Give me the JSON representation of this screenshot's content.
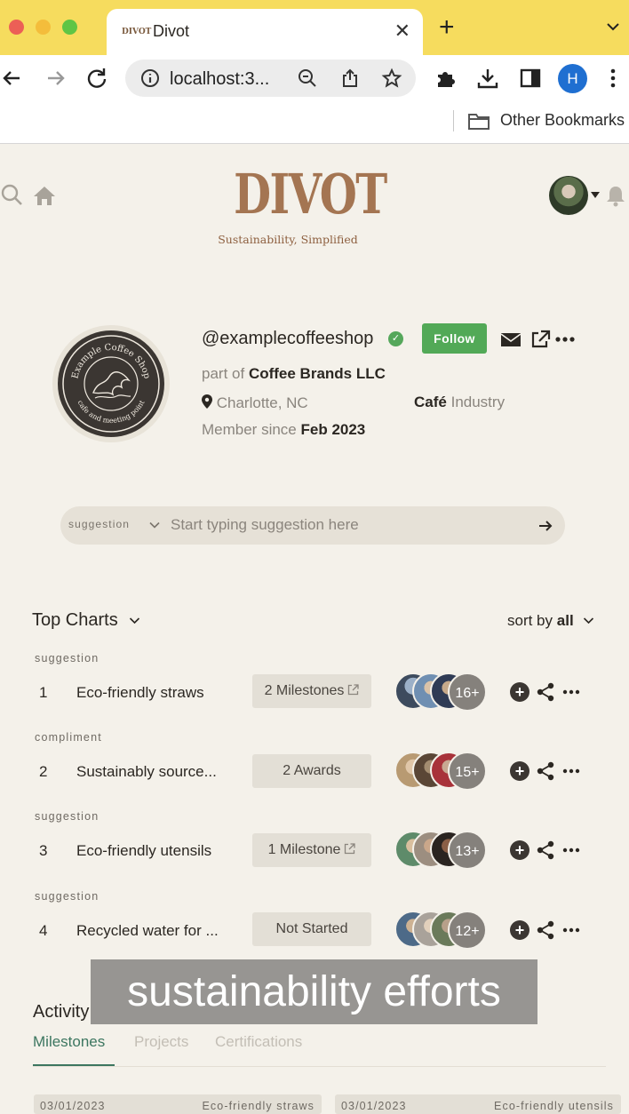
{
  "browser": {
    "tab_title": "Divot",
    "tab_favicon_text": "DIVOT",
    "url": "localhost:3...",
    "profile_initial": "H",
    "bookmark_folder": "Other Bookmarks"
  },
  "site": {
    "logo": "DIVOT",
    "tagline": "Sustainability, Simplified"
  },
  "profile": {
    "handle": "@examplecoffeeshop",
    "follow_label": "Follow",
    "part_of_prefix": "part of",
    "part_of": "Coffee Brands LLC",
    "location": "Charlotte, NC",
    "industry": "Café",
    "industry_suffix": "Industry",
    "member_since_prefix": "Member since",
    "member_since": "Feb 2023",
    "logo_text_top": "Example Coffee Shop",
    "logo_text_bottom": "cafe and meeting point"
  },
  "suggestion_bar": {
    "type": "suggestion",
    "placeholder": "Start typing suggestion here"
  },
  "top_charts": {
    "title": "Top Charts",
    "sort_prefix": "sort by",
    "sort_value": "all",
    "rows": [
      {
        "category": "suggestion",
        "rank": "1",
        "name": "Eco-friendly straws",
        "status": "2 Milestones",
        "status_link": true,
        "count": "16+"
      },
      {
        "category": "compliment",
        "rank": "2",
        "name": "Sustainably source...",
        "status": "2 Awards",
        "status_link": false,
        "count": "15+"
      },
      {
        "category": "suggestion",
        "rank": "3",
        "name": "Eco-friendly utensils",
        "status": "1 Milestone",
        "status_link": true,
        "count": "13+"
      },
      {
        "category": "suggestion",
        "rank": "4",
        "name": "Recycled water for ...",
        "status": "Not Started",
        "status_link": false,
        "count": "12+"
      }
    ]
  },
  "caption": "sustainability efforts",
  "activity": {
    "title": "Activity",
    "tabs": [
      "Milestones",
      "Projects",
      "Certifications"
    ],
    "active_tab": "Milestones",
    "cards": [
      {
        "date": "03/01/2023",
        "title": "Eco-friendly straws"
      },
      {
        "date": "03/01/2023",
        "title": "Eco-friendly utensils"
      }
    ]
  },
  "colors": {
    "tab_strip": "#f6dc5e",
    "page_bg": "#f4f1ea",
    "brand_brown": "#a47552",
    "follow_green": "#52a957",
    "active_tab_green": "#3c7660",
    "pill_bg": "#e3dfd6"
  }
}
